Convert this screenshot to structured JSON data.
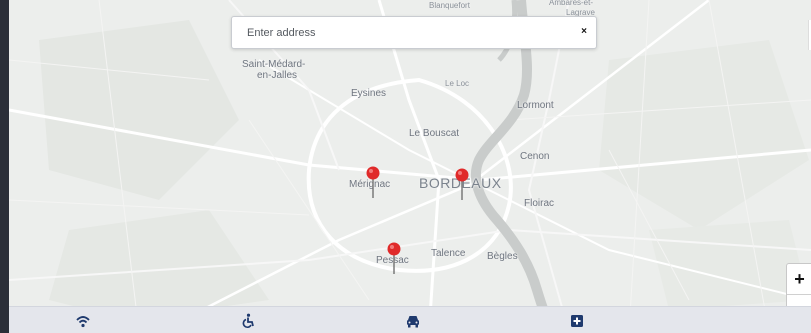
{
  "search": {
    "placeholder": "Enter address",
    "clear_label": "×"
  },
  "places": {
    "top_lagrave_line1": "Ambarès-et-",
    "top_lagrave_line2": "Lagrave",
    "top_left": "Blanquefort",
    "saint_medard_line1": "Saint-Médard-",
    "saint_medard_line2": "en-Jalles",
    "le_loc": "Le Loc",
    "eysines": "Eysines",
    "lormont": "Lormont",
    "le_bouscat": "Le Bouscat",
    "cenon": "Cenon",
    "merignac": "Mérignac",
    "bordeaux": "BORDEAUX",
    "floirac": "Floirac",
    "talence": "Talence",
    "begles": "Bègles",
    "pessac": "Pessac"
  },
  "markers": [
    {
      "name": "marker-merignac",
      "color": "#e02a2a"
    },
    {
      "name": "marker-bordeaux",
      "color": "#e02a2a"
    },
    {
      "name": "marker-pessac",
      "color": "#e02a2a"
    }
  ],
  "zoom": {
    "in_label": "+",
    "out_label": "−"
  },
  "bottom_bar": {
    "icons": [
      "wifi-icon",
      "wheelchair-icon",
      "car-icon",
      "medical-cross-icon"
    ],
    "icon_color": "#1f3a6e"
  }
}
